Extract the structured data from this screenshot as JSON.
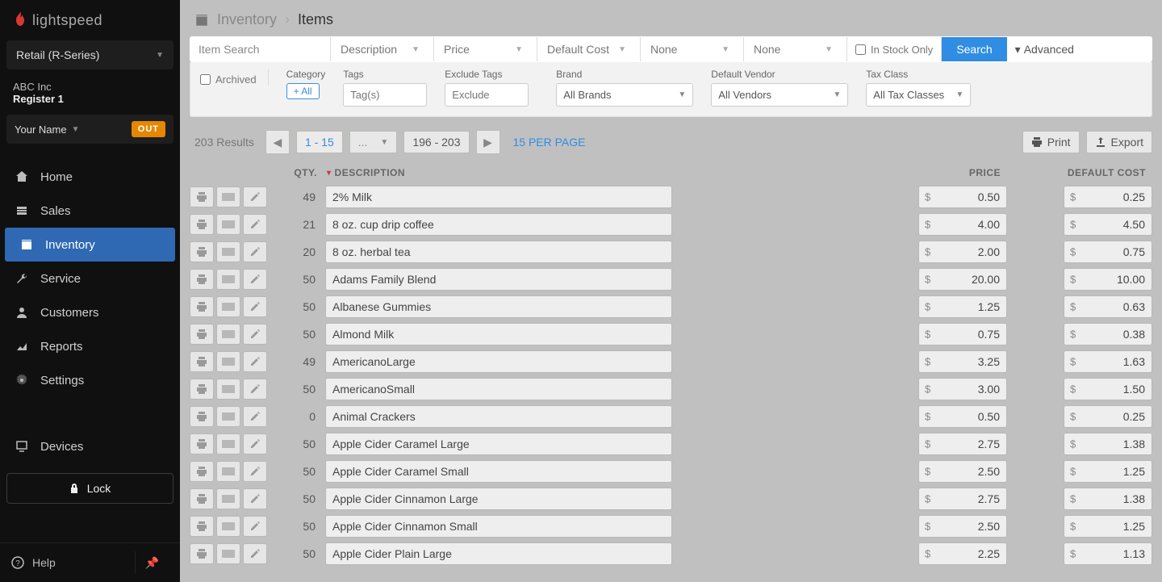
{
  "brand": "lightspeed",
  "series": {
    "label": "Retail (R-Series)"
  },
  "company": {
    "name": "ABC Inc",
    "register": "Register 1"
  },
  "user": {
    "name": "Your Name",
    "out_label": "OUT"
  },
  "nav": {
    "home": "Home",
    "sales": "Sales",
    "inventory": "Inventory",
    "service": "Service",
    "customers": "Customers",
    "reports": "Reports",
    "settings": "Settings",
    "devices": "Devices",
    "lock": "Lock",
    "help": "Help"
  },
  "breadcrumb": {
    "parent": "Inventory",
    "current": "Items"
  },
  "search": {
    "placeholder": "Item Search",
    "description": "Description",
    "price": "Price",
    "default_cost": "Default Cost",
    "none1": "None",
    "none2": "None",
    "in_stock": "In Stock Only",
    "button": "Search",
    "advanced": "Advanced"
  },
  "filters": {
    "archived": "Archived",
    "category_lbl": "Category",
    "all_chip": "+ All",
    "tags_lbl": "Tags",
    "tags_ph": "Tag(s)",
    "exclude_lbl": "Exclude Tags",
    "exclude_ph": "Exclude",
    "brand_lbl": "Brand",
    "brand_val": "All Brands",
    "vendor_lbl": "Default Vendor",
    "vendor_val": "All Vendors",
    "tax_lbl": "Tax Class",
    "tax_val": "All Tax Classes"
  },
  "pager": {
    "results": "203 Results",
    "current": "1 - 15",
    "ellipsis": "...",
    "last": "196 - 203",
    "per_page": "15 PER PAGE",
    "print": "Print",
    "export": "Export"
  },
  "columns": {
    "qty": "QTY.",
    "desc": "DESCRIPTION",
    "price": "PRICE",
    "cost": "DEFAULT COST"
  },
  "rows": [
    {
      "qty": "49",
      "desc": "2% Milk",
      "price": "0.50",
      "cost": "0.25"
    },
    {
      "qty": "21",
      "desc": "8 oz. cup drip coffee",
      "price": "4.00",
      "cost": "4.50"
    },
    {
      "qty": "20",
      "desc": "8 oz. herbal tea",
      "price": "2.00",
      "cost": "0.75"
    },
    {
      "qty": "50",
      "desc": "Adams Family Blend",
      "price": "20.00",
      "cost": "10.00"
    },
    {
      "qty": "50",
      "desc": "Albanese Gummies",
      "price": "1.25",
      "cost": "0.63"
    },
    {
      "qty": "50",
      "desc": "Almond Milk",
      "price": "0.75",
      "cost": "0.38"
    },
    {
      "qty": "49",
      "desc": "AmericanoLarge",
      "price": "3.25",
      "cost": "1.63"
    },
    {
      "qty": "50",
      "desc": "AmericanoSmall",
      "price": "3.00",
      "cost": "1.50"
    },
    {
      "qty": "0",
      "desc": "Animal Crackers",
      "price": "0.50",
      "cost": "0.25"
    },
    {
      "qty": "50",
      "desc": "Apple Cider Caramel Large",
      "price": "2.75",
      "cost": "1.38"
    },
    {
      "qty": "50",
      "desc": "Apple Cider Caramel Small",
      "price": "2.50",
      "cost": "1.25"
    },
    {
      "qty": "50",
      "desc": "Apple Cider Cinnamon Large",
      "price": "2.75",
      "cost": "1.38"
    },
    {
      "qty": "50",
      "desc": "Apple Cider Cinnamon Small",
      "price": "2.50",
      "cost": "1.25"
    },
    {
      "qty": "50",
      "desc": "Apple Cider Plain Large",
      "price": "2.25",
      "cost": "1.13"
    }
  ]
}
